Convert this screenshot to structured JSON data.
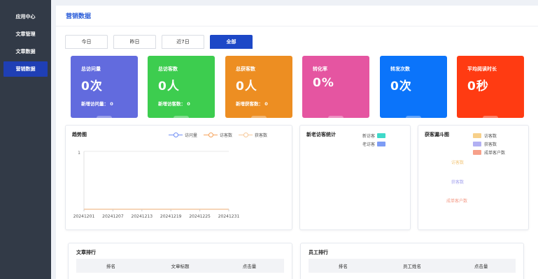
{
  "sidebar": {
    "items": [
      {
        "label": "应用中心"
      },
      {
        "label": "文章管理"
      },
      {
        "label": "文章数据"
      },
      {
        "label": "营销数据"
      }
    ]
  },
  "page": {
    "title": "营销数据"
  },
  "tabs": [
    {
      "label": "今日"
    },
    {
      "label": "昨日"
    },
    {
      "label": "近7日"
    },
    {
      "label": "全部"
    }
  ],
  "cards": [
    {
      "label": "总访问量",
      "value": "0次",
      "sub": "新增访问量： 0",
      "color": "#626bde"
    },
    {
      "label": "总访客数",
      "value": "0人",
      "sub": "新增访客数： 0",
      "color": "#3dcd4f"
    },
    {
      "label": "总获客数",
      "value": "0人",
      "sub": "新增获客数： 0",
      "color": "#ed8e22"
    },
    {
      "label": "转化率",
      "value": "0%",
      "sub": "",
      "color": "#e555a1"
    },
    {
      "label": "转发次数",
      "value": "0次",
      "sub": "",
      "color": "#0b74fa"
    },
    {
      "label": "平均阅读时长",
      "value": "0秒",
      "sub": "",
      "color": "#ff3b12"
    }
  ],
  "trend": {
    "title": "趋势图",
    "legend": [
      {
        "name": "访问量",
        "color": "#6f8ef5"
      },
      {
        "name": "访客数",
        "color": "#f6a25a"
      },
      {
        "name": "获客数",
        "color": "#f7c99a"
      }
    ],
    "y_tick": "1",
    "x_ticks": [
      "20241201",
      "20241207",
      "20241213",
      "20241219",
      "20241225",
      "20241231"
    ]
  },
  "visitor": {
    "title": "新老访客统计",
    "legend": [
      {
        "name": "新访客",
        "color": "#3fd9c9"
      },
      {
        "name": "老访客",
        "color": "#7d9cf5"
      }
    ]
  },
  "funnel": {
    "title": "获客漏斗图",
    "legend": [
      {
        "name": "访客数",
        "color": "#f7d08a"
      },
      {
        "name": "获客数",
        "color": "#b2b0f3"
      },
      {
        "name": "成单客户数",
        "color": "#f7a08a"
      }
    ],
    "labels": [
      "访客数",
      "获客数",
      "成单客户数"
    ]
  },
  "article_rank": {
    "title": "文章排行",
    "headers": [
      "排名",
      "文章标题",
      "点击量"
    ]
  },
  "staff_rank": {
    "title": "员工排行",
    "headers": [
      "排名",
      "员工姓名",
      "点击量"
    ]
  }
}
